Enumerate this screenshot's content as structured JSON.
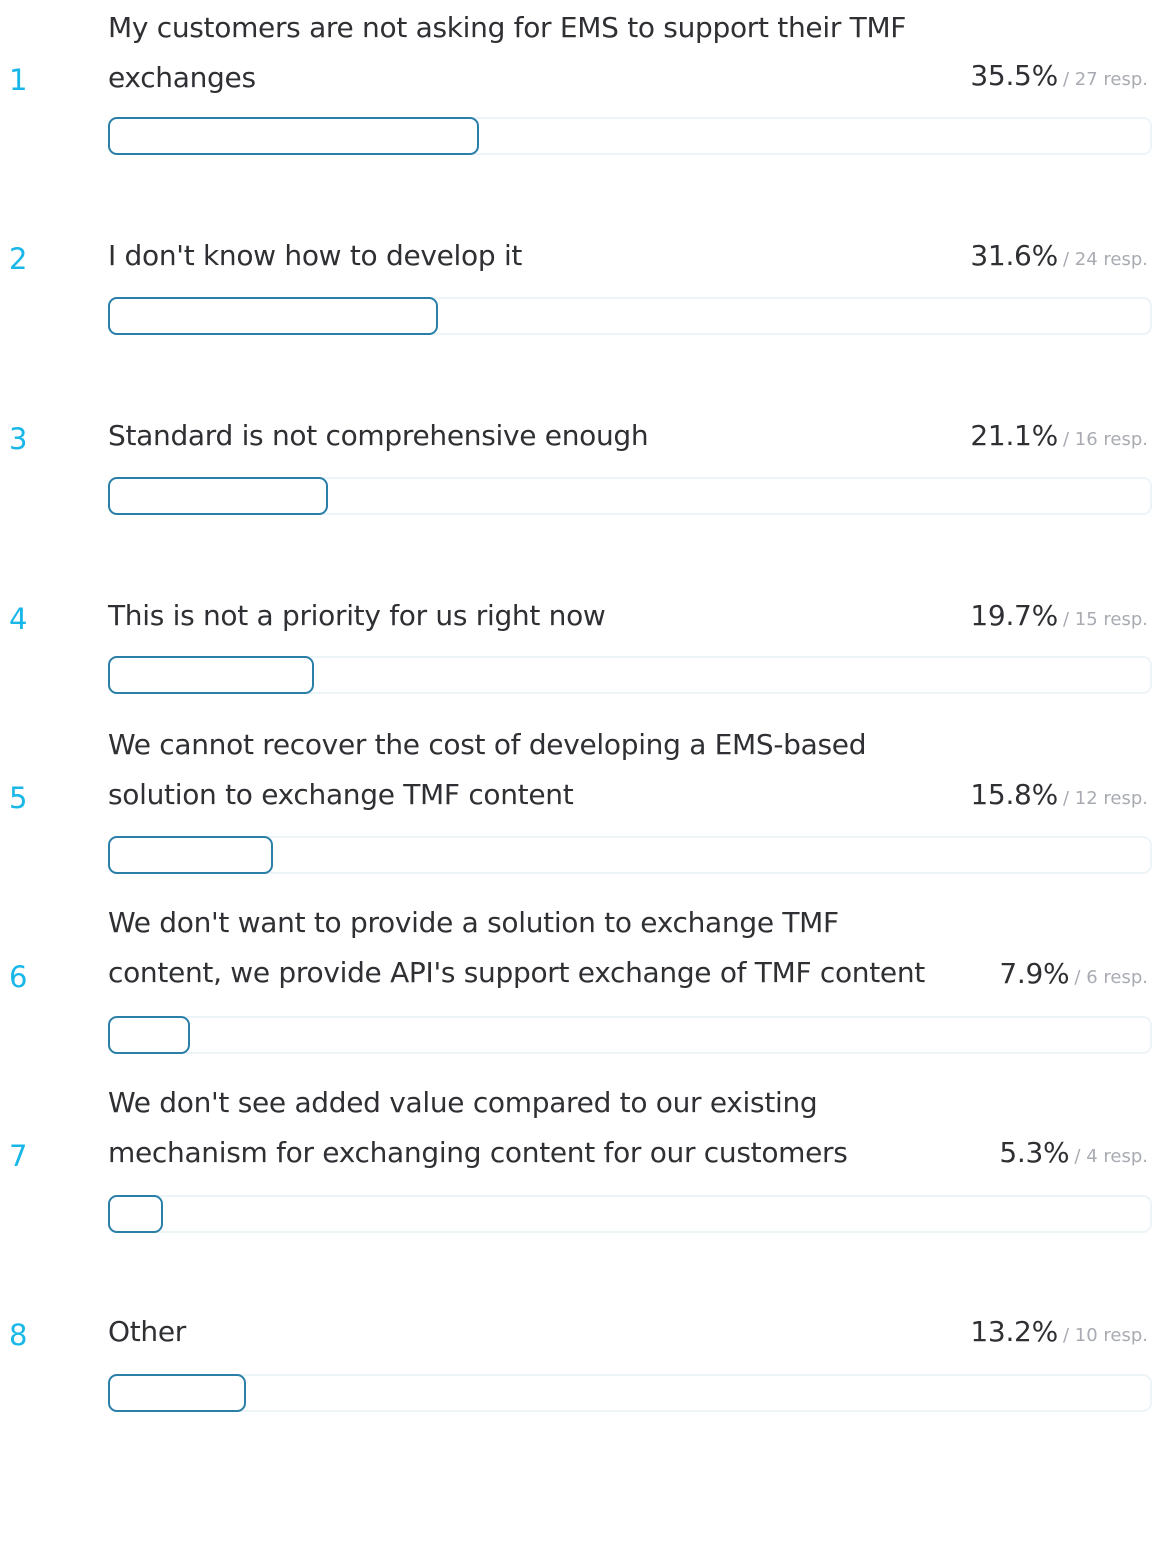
{
  "chart_data": {
    "type": "bar",
    "orientation": "horizontal",
    "categories": [
      "My customers are not asking for EMS to support their TMF exchanges",
      "I don't know how to develop it",
      "Standard is not comprehensive enough",
      "This is not a priority for us right now",
      "We cannot recover the cost of developing a EMS-based solution to exchange TMF content",
      "We don't want to provide a solution to exchange TMF content, we provide API's support exchange of TMF content",
      "We don't see added value compared to our existing mechanism for exchanging content for our customers",
      "Other"
    ],
    "values": [
      35.5,
      31.6,
      21.1,
      19.7,
      15.8,
      7.9,
      5.3,
      13.2
    ],
    "xlim": [
      0,
      100
    ],
    "items": [
      {
        "rank": "1",
        "label": "My customers are not asking for EMS to support their TMF exchanges",
        "percent": "35.5%",
        "responses": "/ 27 resp.",
        "value": 35.5
      },
      {
        "rank": "2",
        "label": "I don't know how to develop it",
        "percent": "31.6%",
        "responses": "/ 24 resp.",
        "value": 31.6
      },
      {
        "rank": "3",
        "label": "Standard is not comprehensive enough",
        "percent": "21.1%",
        "responses": "/ 16 resp.",
        "value": 21.1
      },
      {
        "rank": "4",
        "label": "This is not a priority for us right now",
        "percent": "19.7%",
        "responses": "/ 15 resp.",
        "value": 19.7
      },
      {
        "rank": "5",
        "label": "We cannot recover the cost of developing a EMS-based solution to exchange TMF content",
        "percent": "15.8%",
        "responses": "/ 12 resp.",
        "value": 15.8
      },
      {
        "rank": "6",
        "label": "We don't want to provide a solution to exchange TMF content, we provide API's support exchange of TMF content",
        "percent": "7.9%",
        "responses": "/ 6 resp.",
        "value": 7.9
      },
      {
        "rank": "7",
        "label": "We don't see added value compared to our existing mechanism for exchanging content for our customers",
        "percent": "5.3%",
        "responses": "/ 4 resp.",
        "value": 5.3
      },
      {
        "rank": "8",
        "label": "Other",
        "percent": "13.2%",
        "responses": "/ 10 resp.",
        "value": 13.2
      }
    ]
  },
  "colors": {
    "rank": "#18b7e8",
    "bar_outline": "#2a7fa8",
    "track_outline": "#edf4f8",
    "text": "#2f3033",
    "muted": "#a8abb2"
  }
}
